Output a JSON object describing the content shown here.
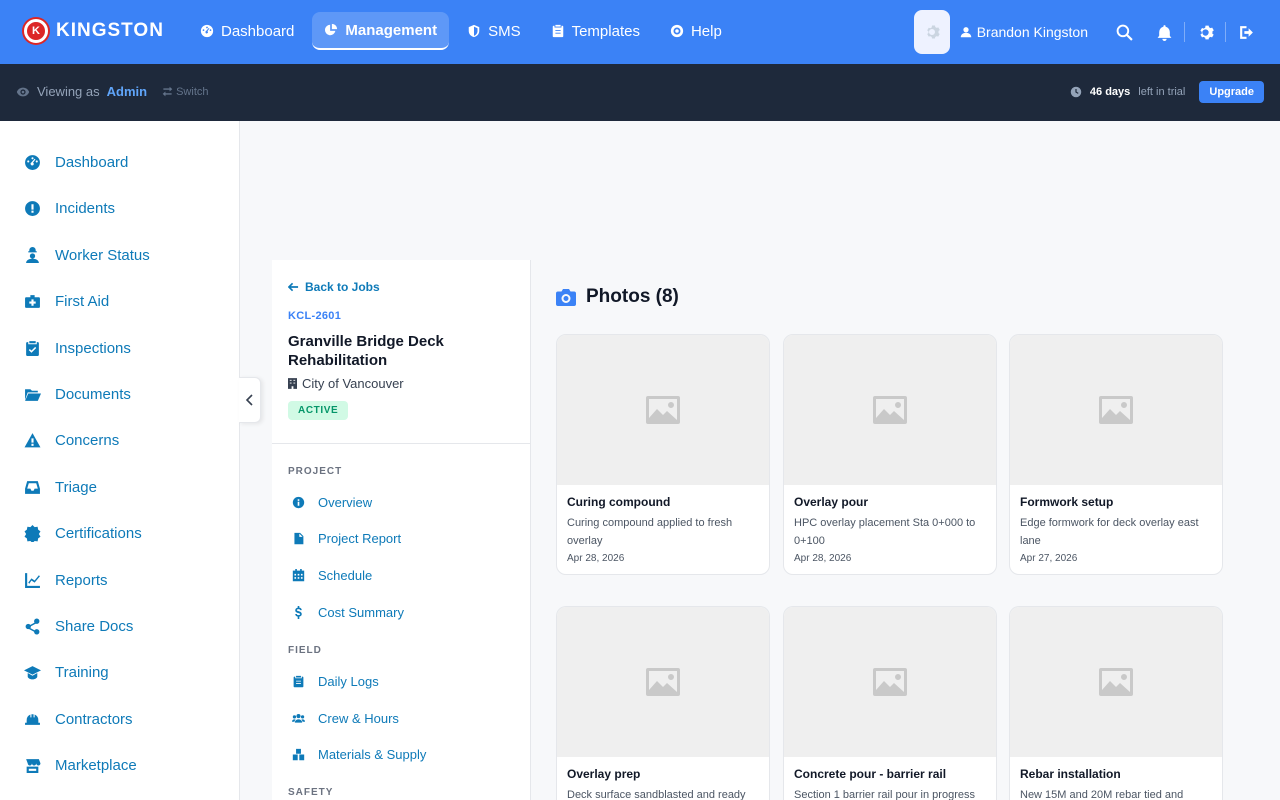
{
  "brand": {
    "name": "KINGSTON",
    "logo_letter": "K"
  },
  "topnav": {
    "items": [
      {
        "label": "Dashboard",
        "icon": "gauge-icon",
        "active": false
      },
      {
        "label": "Management",
        "icon": "pie-chart-icon",
        "active": true
      },
      {
        "label": "SMS",
        "icon": "shield-icon",
        "active": false
      },
      {
        "label": "Templates",
        "icon": "clipboard-icon",
        "active": false
      },
      {
        "label": "Help",
        "icon": "lifebuoy-icon",
        "active": false
      }
    ],
    "user": "Brandon Kingston"
  },
  "subbar": {
    "viewing_as": "Viewing as",
    "role": "Admin",
    "switch": "Switch",
    "trial_days": "46 days",
    "trial_text": "left in trial",
    "upgrade": "Upgrade"
  },
  "sidebar": {
    "items": [
      {
        "label": "Dashboard",
        "icon": "gauge-icon"
      },
      {
        "label": "Incidents",
        "icon": "alert-circle-icon"
      },
      {
        "label": "Worker Status",
        "icon": "worker-icon"
      },
      {
        "label": "First Aid",
        "icon": "medkit-icon"
      },
      {
        "label": "Inspections",
        "icon": "clipboard-check-icon"
      },
      {
        "label": "Documents",
        "icon": "folder-open-icon"
      },
      {
        "label": "Concerns",
        "icon": "warning-icon"
      },
      {
        "label": "Triage",
        "icon": "inbox-icon"
      },
      {
        "label": "Certifications",
        "icon": "certificate-icon"
      },
      {
        "label": "Reports",
        "icon": "line-chart-icon"
      },
      {
        "label": "Share Docs",
        "icon": "share-icon"
      },
      {
        "label": "Training",
        "icon": "graduation-cap-icon"
      },
      {
        "label": "Contractors",
        "icon": "hard-hat-icon"
      },
      {
        "label": "Marketplace",
        "icon": "store-icon"
      }
    ]
  },
  "job": {
    "back": "Back to Jobs",
    "id": "KCL-2601",
    "title": "Granville Bridge Deck Rehabilitation",
    "client": "City of Vancouver",
    "status": "ACTIVE",
    "sections": [
      {
        "label": "PROJECT",
        "items": [
          {
            "label": "Overview",
            "icon": "info-icon"
          },
          {
            "label": "Project Report",
            "icon": "pdf-icon"
          },
          {
            "label": "Schedule",
            "icon": "calendar-icon"
          },
          {
            "label": "Cost Summary",
            "icon": "dollar-icon"
          }
        ]
      },
      {
        "label": "FIELD",
        "items": [
          {
            "label": "Daily Logs",
            "icon": "clipboard-icon"
          },
          {
            "label": "Crew & Hours",
            "icon": "users-icon"
          },
          {
            "label": "Materials & Supply",
            "icon": "boxes-icon"
          }
        ]
      },
      {
        "label": "SAFETY",
        "items": []
      }
    ]
  },
  "photos": {
    "title": "Photos (8)",
    "cards": [
      {
        "title": "Curing compound",
        "desc": "Curing compound applied to fresh overlay",
        "date": "Apr 28, 2026"
      },
      {
        "title": "Overlay pour",
        "desc": "HPC overlay placement Sta 0+000 to 0+100",
        "date": "Apr 28, 2026"
      },
      {
        "title": "Formwork setup",
        "desc": "Edge formwork for deck overlay east lane",
        "date": "Apr 27, 2026"
      },
      {
        "title": "Overlay prep",
        "desc": "Deck surface sandblasted and ready",
        "date": ""
      },
      {
        "title": "Concrete pour - barrier rail",
        "desc": "Section 1 barrier rail pour in progress",
        "date": ""
      },
      {
        "title": "Rebar installation",
        "desc": "New 15M and 20M rebar tied and",
        "date": ""
      }
    ]
  },
  "colors": {
    "primary": "#3b82f6",
    "link": "#0e7ab8",
    "dark": "#1e293b",
    "brand_red": "#dc2626",
    "active_badge": "#059669"
  }
}
